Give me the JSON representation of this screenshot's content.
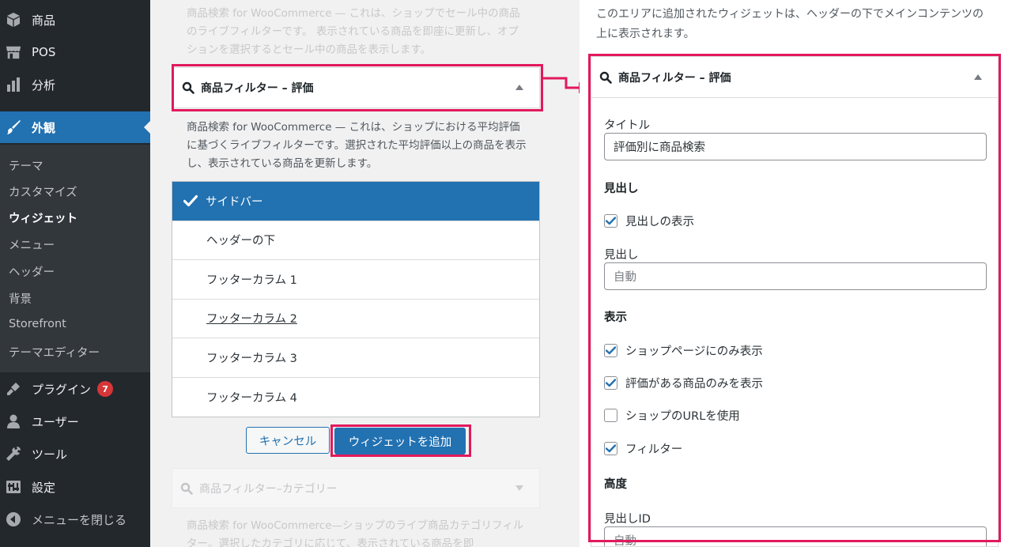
{
  "sidebar": {
    "items": [
      {
        "label": "商品",
        "icon": "cube-icon"
      },
      {
        "label": "POS",
        "icon": "store-icon"
      },
      {
        "label": "分析",
        "icon": "bar-chart-icon"
      },
      {
        "label": "外観",
        "icon": "paintbrush-icon",
        "active": true
      },
      {
        "label": "プラグイン",
        "icon": "plugin-icon",
        "badge": "7"
      },
      {
        "label": "ユーザー",
        "icon": "user-icon"
      },
      {
        "label": "ツール",
        "icon": "wrench-icon"
      },
      {
        "label": "設定",
        "icon": "settings-icon"
      },
      {
        "label": "メニューを閉じる",
        "icon": "collapse-icon"
      }
    ],
    "submenu": [
      "テーマ",
      "カスタマイズ",
      "ウィジェット",
      "メニュー",
      "ヘッダー",
      "背景",
      "Storefront",
      "テーマエディター"
    ],
    "submenu_current": "ウィジェット"
  },
  "middle": {
    "prev_desc": "商品検索 for WooCommerce — これは、ショップでセール中の商品のライブフィルターです。 表示されている商品を即座に更新し、オプションを選択するとセール中の商品を表示します。",
    "widget_title": "商品フィルター – 評価",
    "widget_desc": "商品検索 for WooCommerce — これは、ショップにおける平均評価に基づくライブフィルターです。選択された平均評価以上の商品を表示し、表示されている商品を更新します。",
    "areas": [
      "サイドバー",
      "ヘッダーの下",
      "フッターカラム 1",
      "フッターカラム 2",
      "フッターカラム 3",
      "フッターカラム 4"
    ],
    "selected_area": "サイドバー",
    "cancel_label": "キャンセル",
    "add_label": "ウィジェットを追加",
    "next_widget_title": "商品フィルター–カテゴリー",
    "next_desc": "商品検索 for WooCommerce—ショップのライブ商品カテゴリフィルター。選択したカテゴリに応じて、表示されている商品を即"
  },
  "right": {
    "area_desc": "このエリアに追加されたウィジェットは、ヘッダーの下でメインコンテンツの上に表示されます。",
    "widget_title": "商品フィルター – 評価",
    "title_label": "タイトル",
    "title_value": "評価別に商品検索",
    "heading_section": "見出し",
    "show_heading_label": "見出しの表示",
    "show_heading_checked": true,
    "heading_label": "見出し",
    "heading_placeholder": "自動",
    "display_section": "表示",
    "options": [
      {
        "label": "ショップページにのみ表示",
        "checked": true
      },
      {
        "label": "評価がある商品のみを表示",
        "checked": true
      },
      {
        "label": "ショップのURLを使用",
        "checked": false
      },
      {
        "label": "フィルター",
        "checked": true
      }
    ],
    "height_section": "高度",
    "heading_id_label": "見出しID",
    "heading_id_placeholder": "自動"
  },
  "colors": {
    "sidebar_bg": "#23282d",
    "accent": "#2271b1",
    "highlight": "#e2195c",
    "badge": "#d63638"
  }
}
